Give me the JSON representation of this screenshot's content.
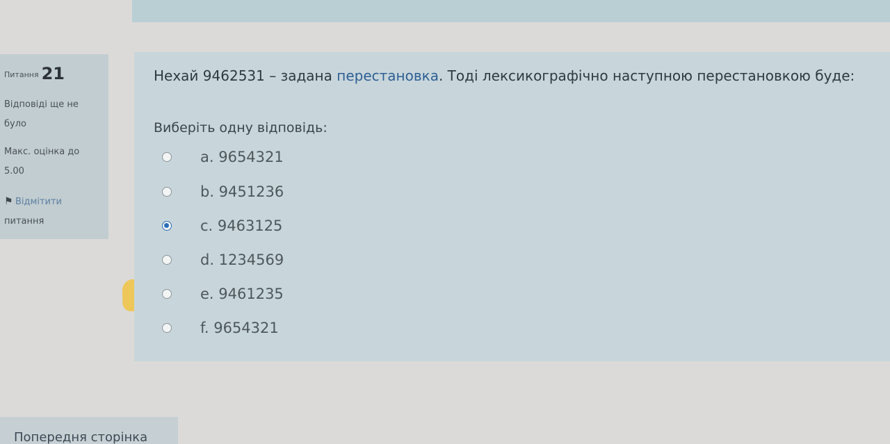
{
  "info": {
    "question_label": "Питання",
    "question_number": "21",
    "status_line1": "Відповіді ще не",
    "status_line2": "було",
    "max_grade_line1": "Макс. оцінка до",
    "max_grade_line2": "5.00",
    "flag_line1": "Відмітити",
    "flag_line2": "питання",
    "flag_icon": "flag-icon"
  },
  "question": {
    "text_before": "Нехай 9462531 – задана ",
    "link_text": "перестановка",
    "text_after": ". Тоді лексикографічно наступною перестановкою буде:",
    "prompt": "Виберіть одну відповідь:",
    "options": [
      {
        "label": "a. 9654321",
        "selected": false
      },
      {
        "label": "b. 9451236",
        "selected": false
      },
      {
        "label": "c. 9463125",
        "selected": true
      },
      {
        "label": "d. 1234569",
        "selected": false
      },
      {
        "label": "e. 9461235",
        "selected": false
      },
      {
        "label": "f. 9654321",
        "selected": false
      }
    ]
  },
  "navigation": {
    "prev_page": "Попередня сторінка"
  },
  "colors": {
    "accent": "#2b6db5",
    "link": "#2f5f94",
    "highlight": "#f2c23f"
  }
}
